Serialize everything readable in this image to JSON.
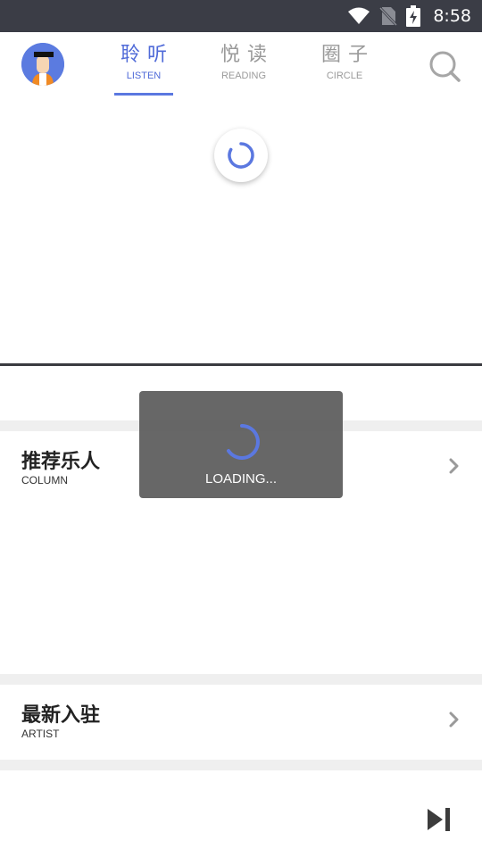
{
  "status_bar": {
    "time": "8:58",
    "icons": [
      "wifi-icon",
      "no-sim-icon",
      "battery-charging-icon"
    ]
  },
  "nav": {
    "tabs": [
      {
        "zh": "聆听",
        "en": "LISTEN",
        "active": true
      },
      {
        "zh": "悦读",
        "en": "READING",
        "active": false
      },
      {
        "zh": "圈子",
        "en": "CIRCLE",
        "active": false
      }
    ],
    "search_icon": "search-icon",
    "avatar_icon": "avatar"
  },
  "sections": [
    {
      "title": "推荐乐人",
      "subtitle": "COLUMN"
    },
    {
      "title": "最新入驻",
      "subtitle": "ARTIST"
    }
  ],
  "loading": {
    "label": "LOADING..."
  },
  "player": {
    "next_icon": "skip-next-icon"
  },
  "colors": {
    "accent": "#4f6ad8",
    "status_bar": "#3b3d46",
    "inactive_tab": "#9a9a9a",
    "band": "#efefef",
    "toast": "#5a5a5a"
  }
}
